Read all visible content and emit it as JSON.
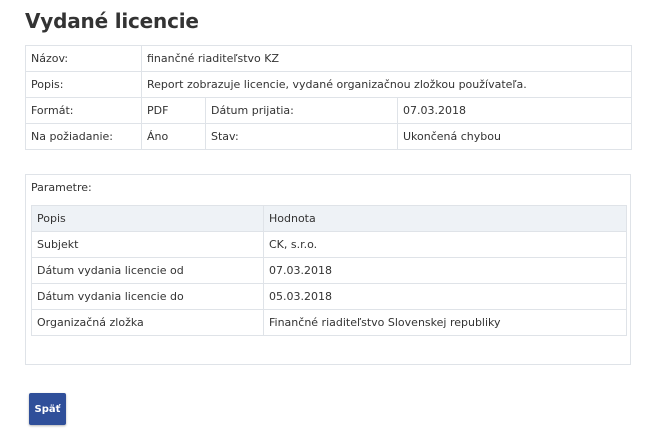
{
  "page": {
    "title": "Vydané licencie"
  },
  "info": {
    "name_label": "Názov:",
    "name_value": "finančné riaditeľstvo KZ",
    "description_label": "Popis:",
    "description_value": "Report zobrazuje licencie, vydané organizačnou zložkou používateľa.",
    "format_label": "Formát:",
    "format_value": "PDF",
    "received_label": "Dátum prijatia:",
    "received_value": "07.03.2018",
    "on_demand_label": "Na požiadanie:",
    "on_demand_value": "Áno",
    "status_label": "Stav:",
    "status_value": "Ukončená chybou"
  },
  "parameters": {
    "label": "Parametre:",
    "columns": [
      "Popis",
      "Hodnota"
    ],
    "rows": [
      [
        "Subjekt",
        "CK, s.r.o."
      ],
      [
        "Dátum vydania licencie od",
        "07.03.2018"
      ],
      [
        "Dátum vydania licencie do",
        "05.03.2018"
      ],
      [
        "Organizačná zložka",
        "Finančné riaditeľstvo Slovenskej republiky"
      ]
    ]
  },
  "actions": {
    "back_label": "Späť"
  },
  "colors": {
    "button_bg": "#2f4f9a",
    "table_border": "#dfe3e8",
    "header_bg": "#eef2f6"
  }
}
